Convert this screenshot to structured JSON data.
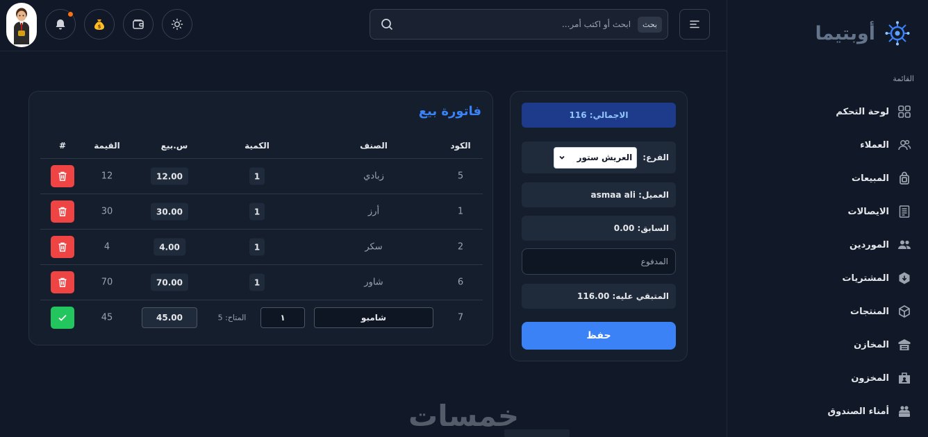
{
  "brand": {
    "name": "أوبتيما"
  },
  "sidebar": {
    "heading": "القائمة",
    "items": [
      {
        "label": "لوحة التحكم",
        "icon": "grid-icon"
      },
      {
        "label": "العملاء",
        "icon": "users-icon"
      },
      {
        "label": "المبيعات",
        "icon": "bag-icon"
      },
      {
        "label": "الايصالات",
        "icon": "receipt-icon"
      },
      {
        "label": "الموردين",
        "icon": "people-icon"
      },
      {
        "label": "المشتريات",
        "icon": "box-download-icon"
      },
      {
        "label": "المنتجات",
        "icon": "cube-icon"
      },
      {
        "label": "المخازن",
        "icon": "warehouse-icon"
      },
      {
        "label": "المخزون",
        "icon": "inventory-icon"
      },
      {
        "label": "أمناء الصندوق",
        "icon": "cashier-icon"
      }
    ]
  },
  "header": {
    "search": {
      "badge": "بحث",
      "placeholder": "ابحث أو اكتب أمر..."
    },
    "icons": [
      "menu-icon",
      "search-icon",
      "sun-icon",
      "wallet-icon",
      "money-bag-icon",
      "bell-icon"
    ],
    "notification_color": "#f97316"
  },
  "summary": {
    "total": "الاجمالي: 116",
    "branch_label": "الفرع:",
    "branch_value": "العريش ستور",
    "customer": "العميل: asmaa ali",
    "previous": "السابق: 0.00",
    "paid_placeholder": "المدفوع",
    "remaining": "المتبقي عليه: 116.00",
    "save_label": "حفظ"
  },
  "invoice": {
    "title": "فاتورة بيع",
    "columns": {
      "code": "الكود",
      "item": "الصنف",
      "qty": "الكمية",
      "price": "س.بيع",
      "value": "القيمة",
      "index": "#"
    },
    "rows": [
      {
        "code": "5",
        "item": "زبادي",
        "qty": "1",
        "price": "12.00",
        "value": "12"
      },
      {
        "code": "1",
        "item": "أرز",
        "qty": "1",
        "price": "30.00",
        "value": "30"
      },
      {
        "code": "2",
        "item": "سكر",
        "qty": "1",
        "price": "4.00",
        "value": "4"
      },
      {
        "code": "6",
        "item": "شاور",
        "qty": "1",
        "price": "70.00",
        "value": "70"
      }
    ],
    "edit_row": {
      "code": "7",
      "item": "شامبو",
      "available": "المتاح: 5",
      "qty": "١",
      "price": "45.00",
      "value": "45"
    }
  },
  "watermark": {
    "text": "خمسات"
  },
  "colors": {
    "accent": "#3b82f6",
    "danger": "#ef4444",
    "success": "#22c55e",
    "total_bg": "#1e3a8a"
  }
}
